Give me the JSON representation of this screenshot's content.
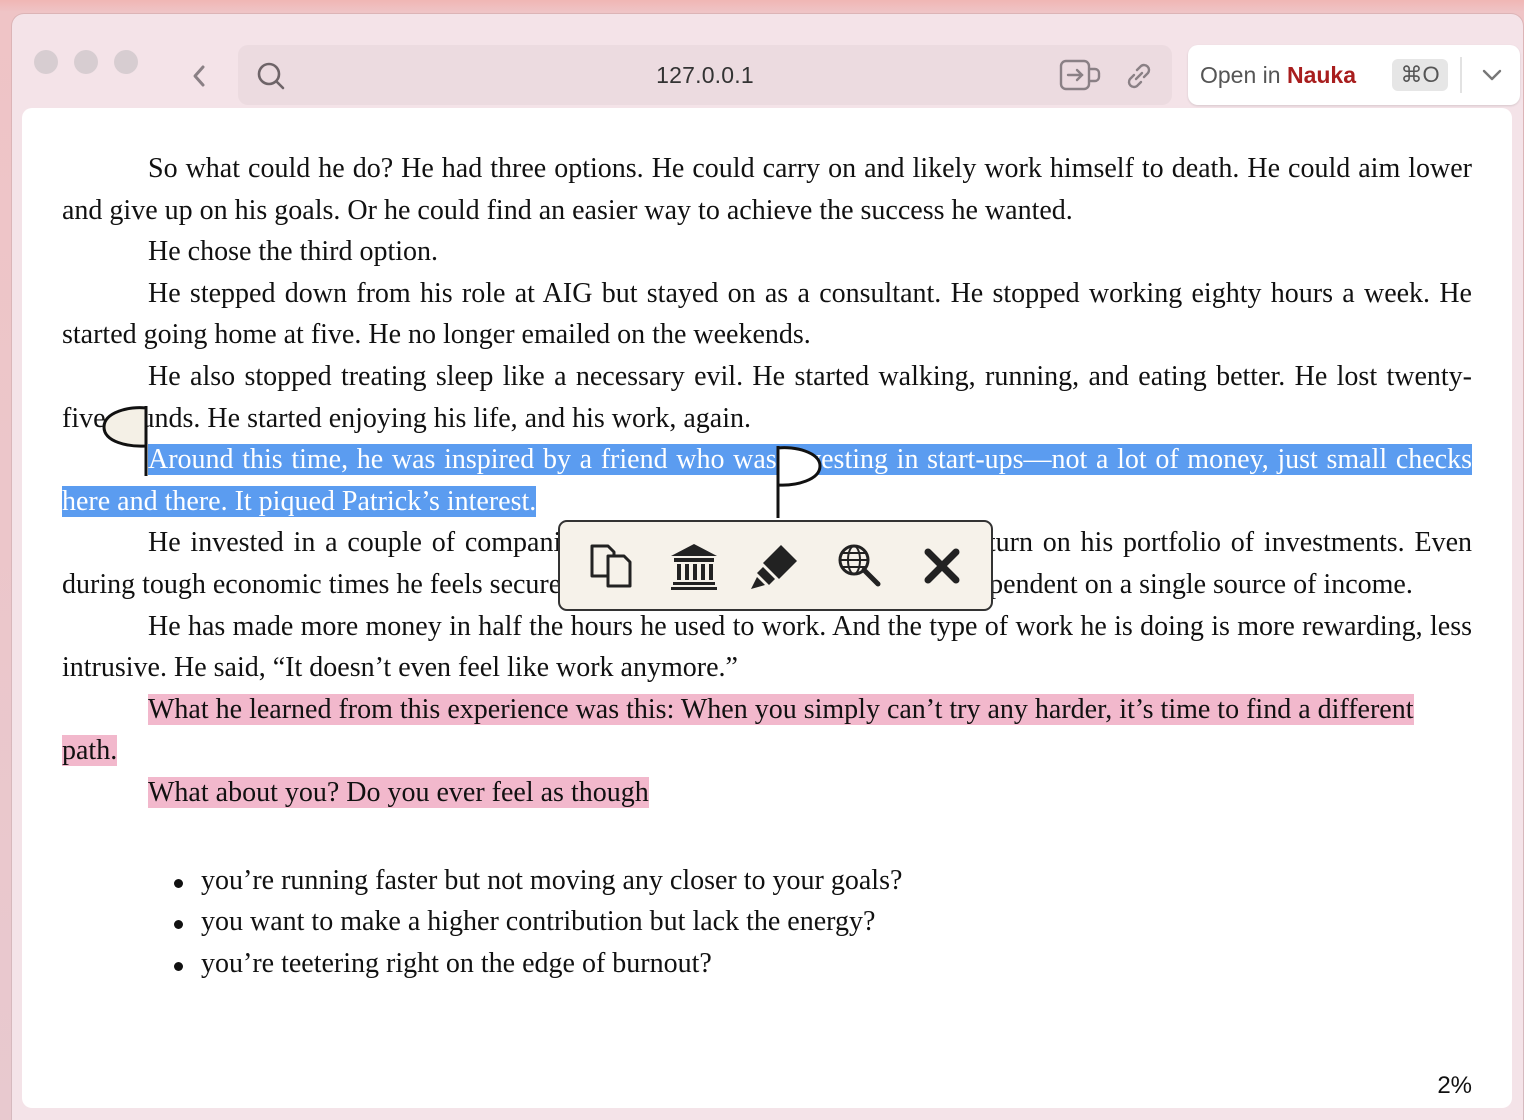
{
  "browser": {
    "url": "127.0.0.1",
    "open_in_prefix": "Open in",
    "open_in_app": "Nauka",
    "open_in_shortcut": "⌘O"
  },
  "book": {
    "p1": "So what could he do? He had three options. He could carry on and likely work himself to death. He could aim lower and give up on his goals. Or he could find an easier way to achieve the success he wanted.",
    "p2": "He chose the third option.",
    "p3": "He stepped down from his role at AIG but stayed on as a consultant. He stopped working eighty hours a week. He started going home at five. He no longer emailed on the weekends.",
    "p4": "He also stopped treating sleep like a necessary evil. He started walking, running, and eating better. He lost twenty-five pounds. He started enjoying his life, and his work, again.",
    "p5_selected": "Around this time, he was inspired by a friend who was investing in start-ups—not a lot of money, just small checks here and there. It piqued Patrick’s interest.",
    "p6": "He invested in a couple of companies and he has been getting a good return on his portfolio of investments. Even during tough economic times he feels secure about his finances because he isn’t dependent on a single source of income.",
    "p7": "He has made more money in half the hours he used to work. And the type of work he is doing is more rewarding, less intrusive. He said, “It doesn’t even feel like work anymore.”",
    "p8_highlighted": "What he learned from this experience was this: When you simply can’t try any harder, it’s time to find a different path.",
    "p9_highlighted": "What about you? Do you ever feel as though",
    "bullets": [
      "you’re running faster but not moving any closer to your goals?",
      "you want to make a higher contribution but lack the energy?",
      "you’re teetering right on the edge of burnout?"
    ]
  },
  "selection_toolbar": {
    "icons": [
      "copy-icon",
      "bank-icon",
      "highlighter-icon",
      "web-search-icon",
      "close-icon"
    ]
  },
  "reading_progress": "2%",
  "colors": {
    "selection": "#5b9cf0",
    "highlight": "#f2b8cc",
    "app_accent": "#a81e1e"
  }
}
